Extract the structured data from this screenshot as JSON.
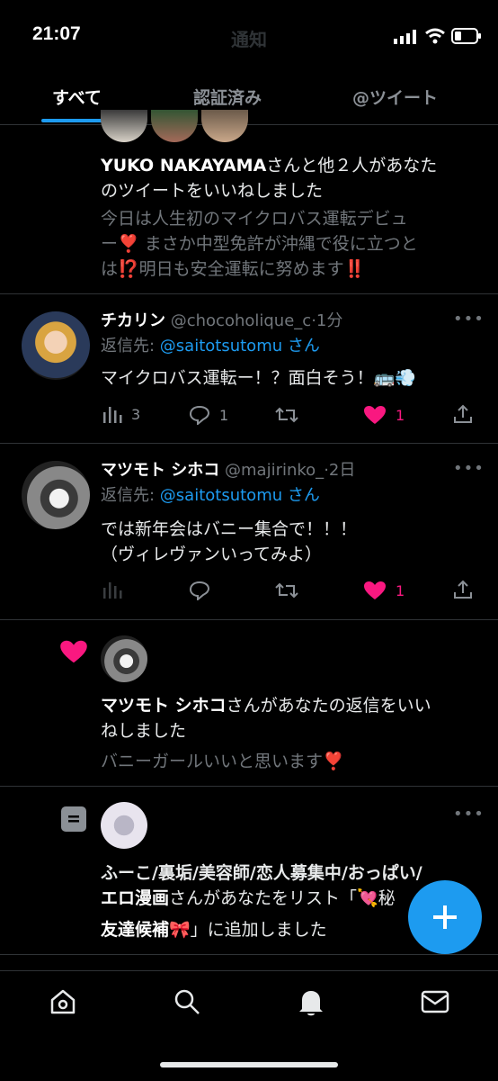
{
  "status_bar": {
    "time": "21:07"
  },
  "header": {
    "title": "通知"
  },
  "tabs": [
    {
      "label": "すべて",
      "active": true
    },
    {
      "label": "認証済み",
      "active": false
    },
    {
      "label": "@ツイート",
      "active": false
    }
  ],
  "notifications": {
    "like_group": {
      "bold_name": "YUKO NAKAYAMA",
      "action_text": "さんと他２人があなた",
      "action_text_2": "のツイートをいいねしました",
      "quote_line1": "今日は人生初のマイクロバス運転デビュ",
      "quote_line2": "ー❣️ まさか中型免許が沖縄で役に立つと",
      "quote_line3": "は⁉️明日も安全運転に努めます‼️"
    },
    "reply1": {
      "name": "チカリン",
      "handle": "@chocoholique_c",
      "time": "·1分",
      "reply_prefix": "返信先: ",
      "reply_to": "@saitotsutomu",
      "reply_suffix": " さん",
      "text": "マイクロバス運転ー！？面白そう！🚌💨",
      "views": "3",
      "replies": "1",
      "retweets": "",
      "likes": "1"
    },
    "reply2": {
      "name": "マツモト シホコ",
      "handle": "@majirinko_",
      "time": "·2日",
      "reply_prefix": "返信先: ",
      "reply_to": "@saitotsutomu",
      "reply_suffix": " さん",
      "text_line1": "では新年会はバニー集合で！！！",
      "text_line2": "（ヴィレヴァンいってみよ）",
      "replies": "",
      "retweets": "",
      "likes": "1"
    },
    "like_reply": {
      "bold_name": "マツモト シホコ",
      "action_text": "さんがあなたの返信をいい",
      "action_text_2": "ねしました",
      "quote": "バニーガールいいと思います❣️"
    },
    "list_add": {
      "bold_line1": "ふーこ/裏垢/美容師/恋人募集中/おっぱい/",
      "bold_line2": "エロ漫画",
      "action_text": "さんがあなたをリスト「💘秘",
      "list_name": "友達候補🎀",
      "action_text_2": "」に追加しました"
    }
  },
  "colors": {
    "accent": "#1d9bf0",
    "like": "#f91880",
    "background": "#000000"
  },
  "icons": [
    "home-icon",
    "search-icon",
    "bell-icon",
    "mail-icon",
    "plus-icon",
    "heart-icon",
    "list-icon"
  ]
}
